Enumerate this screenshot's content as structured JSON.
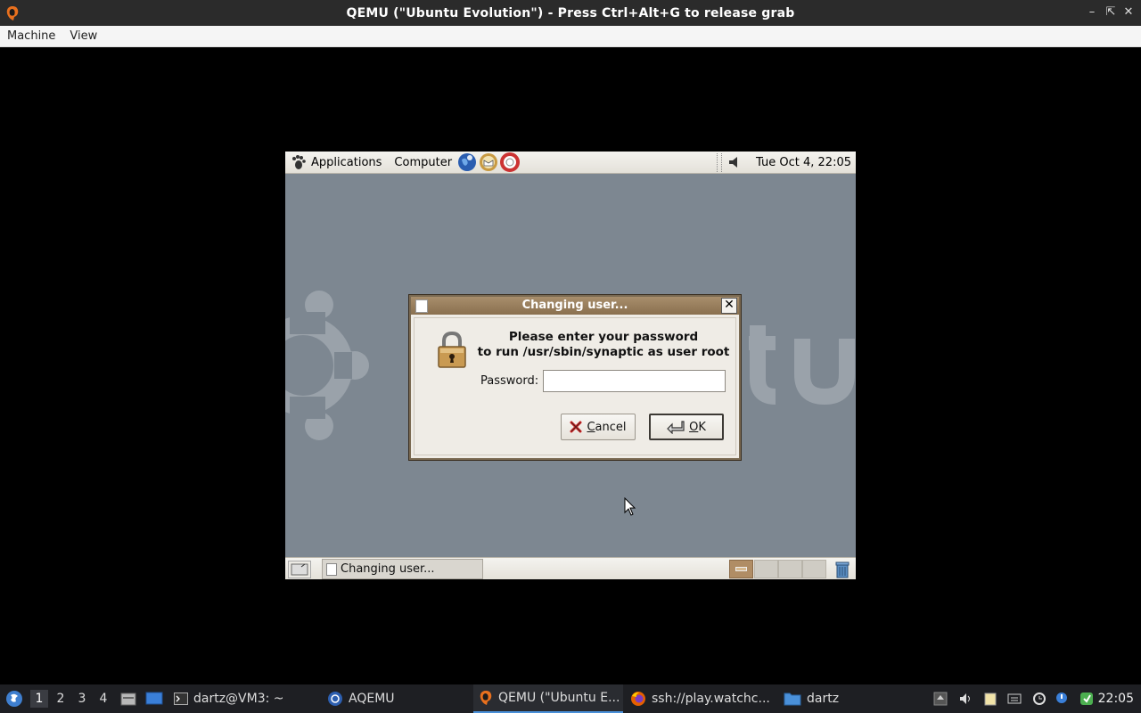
{
  "host_window": {
    "title": "QEMU (\"Ubuntu Evolution\") - Press Ctrl+Alt+G to release grab",
    "controls": [
      "minimize",
      "maximize",
      "close"
    ],
    "menu": [
      "Machine",
      "View"
    ]
  },
  "guest_top_panel": {
    "menus": [
      "Applications",
      "Computer"
    ],
    "launchers": [
      "web-browser-icon",
      "email-icon",
      "help-icon"
    ],
    "clock": "Tue Oct  4, 22:05"
  },
  "dialog": {
    "title": "Changing user...",
    "message_line1": "Please enter your password",
    "message_line2": "to run /usr/sbin/synaptic as user root",
    "password_label": "Password:",
    "password_value": "",
    "cancel_label": "Cancel",
    "cancel_mnemonic": "C",
    "cancel_rest": "ancel",
    "ok_mnemonic": "O",
    "ok_rest": "K"
  },
  "guest_bottom_panel": {
    "task_label": "Changing user...",
    "workspaces": 4,
    "active_workspace": 1
  },
  "taskbar": {
    "workspaces": [
      "1",
      "2",
      "3",
      "4"
    ],
    "active_workspace": "1",
    "tasks": [
      {
        "label": "dartz@VM3: ~",
        "icon": "terminal-icon"
      },
      {
        "label": "AQEMU",
        "icon": "aqemu-icon"
      },
      {
        "label": "QEMU (\"Ubuntu E...",
        "icon": "qemu-icon",
        "active": true
      },
      {
        "label": "ssh://play.watchc...",
        "icon": "firefox-icon"
      },
      {
        "label": "dartz",
        "icon": "folder-icon"
      }
    ],
    "clock": "22:05"
  },
  "colors": {
    "guest_desktop": "#7d8791",
    "dialog_title": "#8a704f",
    "host_titlebar": "#2b2b2b",
    "taskbar": "#1e1f23"
  }
}
